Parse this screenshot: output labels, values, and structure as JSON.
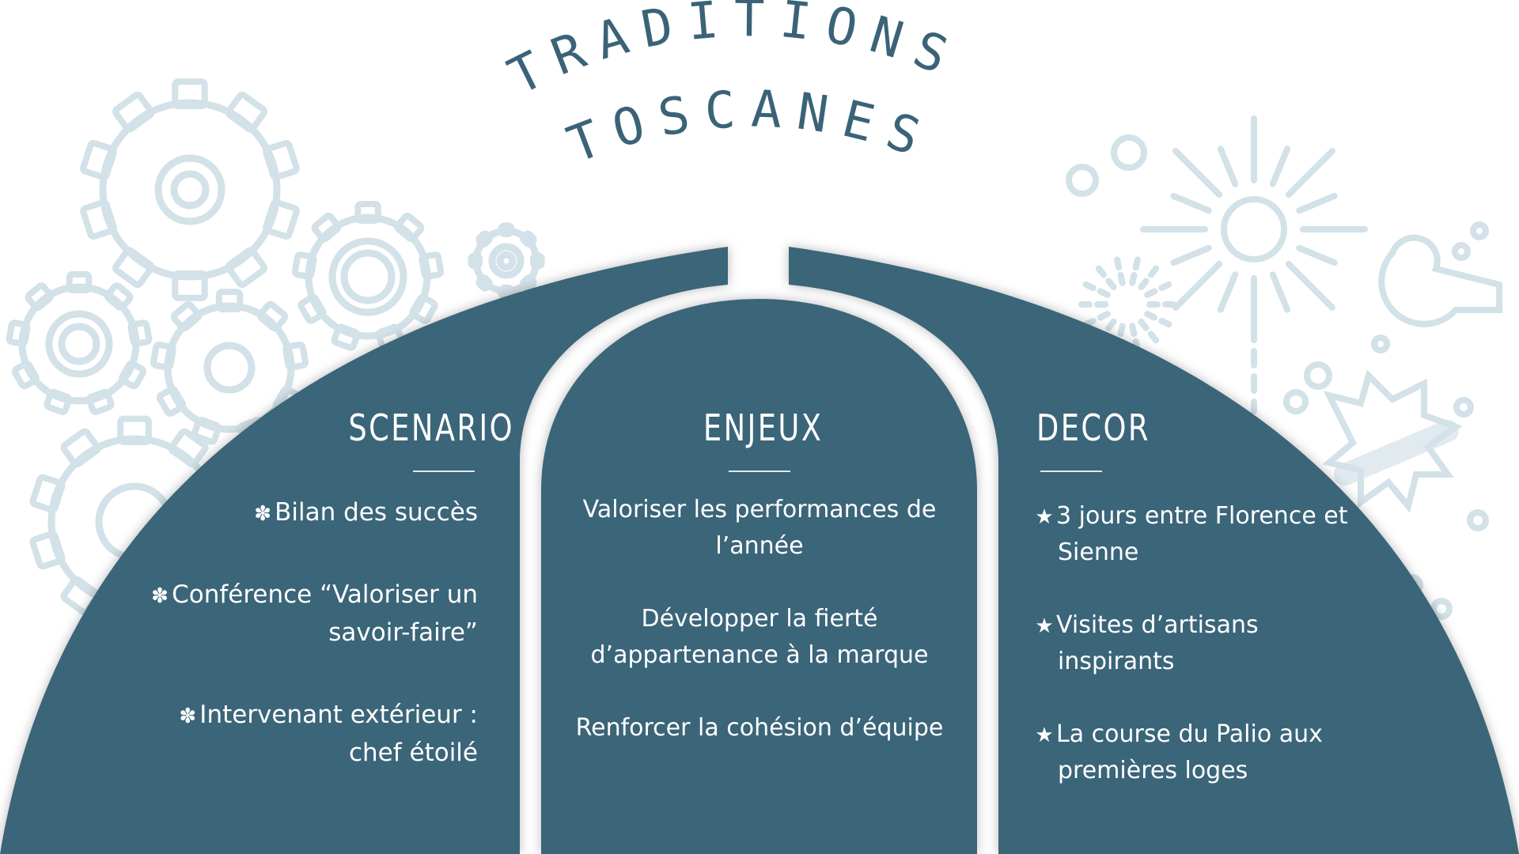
{
  "title": {
    "line1": "TRADITIONS",
    "line2": "TOSCANES"
  },
  "colors": {
    "panel": "#3b6579",
    "decoration": "#d3e1e8",
    "title": "#3a6378",
    "text": "#ffffff"
  },
  "columns": {
    "scenario": {
      "heading": "SCENARIO",
      "bullet_icon": "gear-icon",
      "items": [
        "Bilan des succès",
        "Conférence “Valoriser un savoir-faire”",
        "Intervenant extérieur : chef étoilé"
      ]
    },
    "enjeux": {
      "heading": "ENJEUX",
      "items": [
        "Valoriser les performances de l’année",
        "Développer la fierté d’appartenance à la marque",
        "Renforcer la cohésion d’équipe"
      ]
    },
    "decor": {
      "heading": "DECOR",
      "bullet_icon": "star-icon",
      "items": [
        "3 jours entre Florence et Sienne",
        "Visites d’artisans inspirants",
        "La course du Palio aux premières loges"
      ]
    }
  },
  "decorations": {
    "left": "gears-icon",
    "right": "fireworks-icon"
  }
}
